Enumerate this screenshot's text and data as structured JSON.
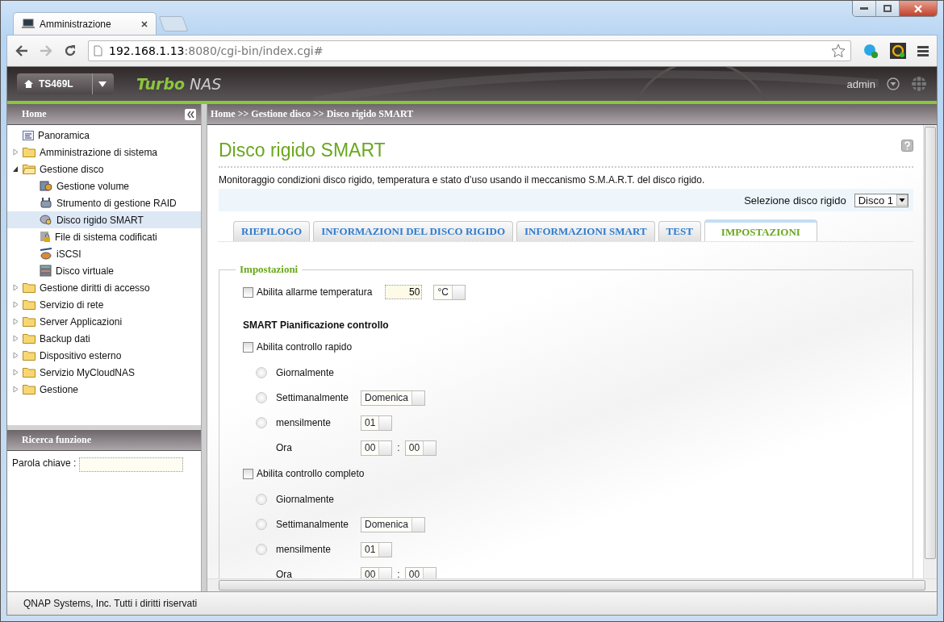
{
  "browser": {
    "tab_title": "Amministrazione",
    "url_host": "192.168.1.13",
    "url_rest": ":8080/cgi-bin/index.cgi#"
  },
  "nas_header": {
    "device": "TS469L",
    "brand_bold": "Turbo",
    "brand_light": "NAS",
    "user": "admin"
  },
  "sidebar": {
    "title": "Home",
    "items": [
      {
        "label": "Panoramica",
        "kind": "page",
        "selected": false
      },
      {
        "label": "Amministrazione di sistema",
        "kind": "folder",
        "expanded": false,
        "selected": false
      },
      {
        "label": "Gestione disco",
        "kind": "folder",
        "expanded": true,
        "selected": false,
        "children": [
          {
            "label": "Gestione volume",
            "kind": "disk",
            "selected": false
          },
          {
            "label": "Strumento di gestione RAID",
            "kind": "raid",
            "selected": false
          },
          {
            "label": "Disco rigido SMART",
            "kind": "smart",
            "selected": true
          },
          {
            "label": "File di sistema codificati",
            "kind": "lock",
            "selected": false
          },
          {
            "label": "iSCSI",
            "kind": "iscsi",
            "selected": false
          },
          {
            "label": "Disco virtuale",
            "kind": "stack",
            "selected": false
          }
        ]
      },
      {
        "label": "Gestione diritti di accesso",
        "kind": "folder",
        "expanded": false,
        "selected": false
      },
      {
        "label": "Servizio di rete",
        "kind": "folder",
        "expanded": false,
        "selected": false
      },
      {
        "label": "Server Applicazioni",
        "kind": "folder",
        "expanded": false,
        "selected": false
      },
      {
        "label": "Backup dati",
        "kind": "folder",
        "expanded": false,
        "selected": false
      },
      {
        "label": "Dispositivo esterno",
        "kind": "folder",
        "expanded": false,
        "selected": false
      },
      {
        "label": "Servizio MyCloudNAS",
        "kind": "folder",
        "expanded": false,
        "selected": false
      },
      {
        "label": "Gestione",
        "kind": "folder",
        "expanded": false,
        "selected": false
      }
    ]
  },
  "search": {
    "title": "Ricerca funzione",
    "label": "Parola chiave :"
  },
  "breadcrumb": "Home >> Gestione disco >> Disco rigido SMART",
  "page": {
    "title": "Disco rigido SMART",
    "description": "Monitoraggio condizioni disco rigido, temperatura e stato d’uso usando il meccanismo S.M.A.R.T. del disco rigido.",
    "disk_select": {
      "label": "Selezione disco rigido",
      "value": "Disco 1"
    },
    "tabs": [
      {
        "label": "RIEPILOGO",
        "selected": false
      },
      {
        "label": "INFORMAZIONI DEL DISCO RIGIDO",
        "selected": false
      },
      {
        "label": "INFORMAZIONI SMART",
        "selected": false
      },
      {
        "label": "TEST",
        "selected": false
      },
      {
        "label": "IMPOSTAZIONI",
        "selected": true
      }
    ],
    "settings": {
      "legend": "Impostazioni",
      "temperature_alarm": {
        "label": "Abilita allarme temperatura",
        "checked": false,
        "value": "50",
        "unit": "°C"
      },
      "schedule_heading": "SMART Pianificazione controllo",
      "schedules": [
        {
          "label": "Abilita controllo rapido",
          "checked": false,
          "options": [
            {
              "label": "Giornalmente",
              "kind": "plain",
              "selected": false
            },
            {
              "label": "Settimanalmente",
              "kind": "select",
              "value": "Domenica",
              "selected": false
            },
            {
              "label": "mensilmente",
              "kind": "select",
              "value": "01",
              "selected": false
            }
          ],
          "time": {
            "label": "Ora",
            "hour": "00",
            "separator": ":",
            "minute": "00"
          }
        },
        {
          "label": "Abilita controllo completo",
          "checked": false,
          "options": [
            {
              "label": "Giornalmente",
              "kind": "plain",
              "selected": false
            },
            {
              "label": "Settimanalmente",
              "kind": "select",
              "value": "Domenica",
              "selected": false
            },
            {
              "label": "mensilmente",
              "kind": "select",
              "value": "01",
              "selected": false
            }
          ],
          "time": {
            "label": "Ora",
            "hour": "00",
            "separator": ":",
            "minute": "00"
          }
        }
      ]
    }
  },
  "footer": "QNAP Systems, Inc. Tutti i diritti riservati"
}
